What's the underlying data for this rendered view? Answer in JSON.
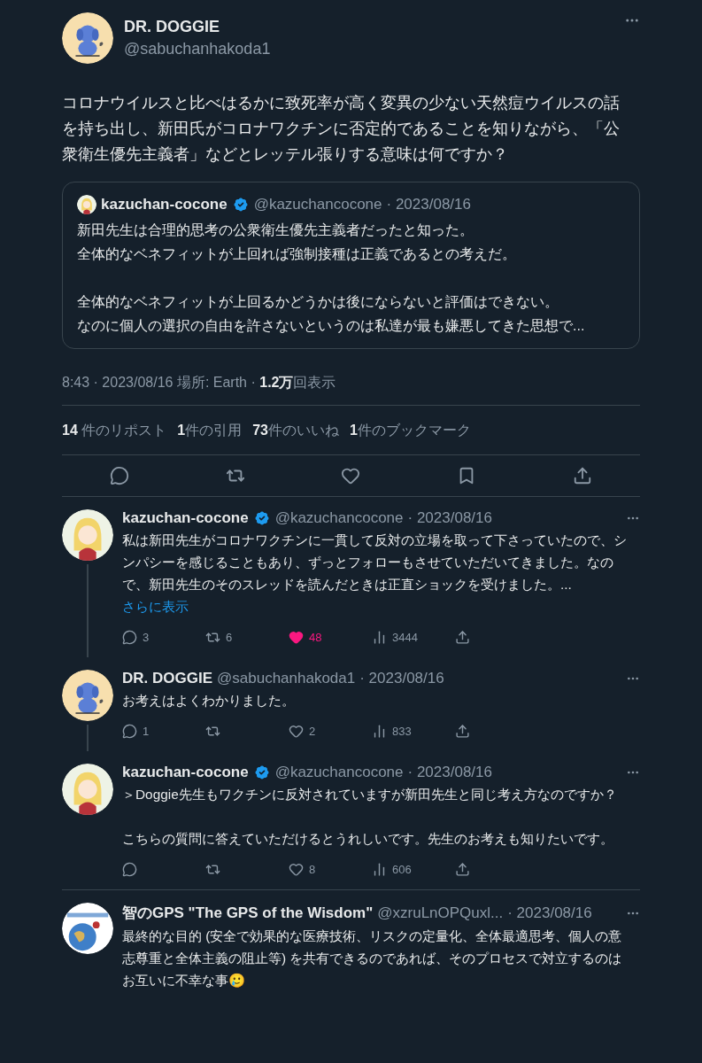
{
  "main_tweet": {
    "author": "DR. DOGGIE",
    "handle": "@sabuchanhakoda1",
    "kind": "dog",
    "text": "コロナウイルスと比べはるかに致死率が高く変異の少ない天然痘ウイルスの話を持ち出し、新田氏がコロナワクチンに否定的であることを知りながら、「公衆衛生優先主義者」などとレッテル張りする意味は何ですか？",
    "quote": {
      "author": "kazuchan-cocone",
      "verified": true,
      "handle": "@kazuchancocone",
      "date": "· 2023/08/16",
      "kind": "girl",
      "paragraphs": [
        [
          "新田先生は合理的思考の公衆衛生優先主義者だったと知った。",
          "全体的なベネフィットが上回れば強制接種は正義であるとの考えだ。"
        ],
        [
          "全体的なベネフィットが上回るかどうかは後にならないと評価はできない。",
          "なのに個人の選択の自由を許さないというのは私達が最も嫌悪してきた思想で..."
        ]
      ]
    },
    "meta": "8:43 · 2023/08/16 場所: Earth · **1.2万**回表示",
    "stats": [
      "**14** 件のリポスト",
      "**1**件の引用",
      "**73**件のいいね",
      "**1**件のブックマーク"
    ]
  },
  "replies": [
    {
      "author": "kazuchan-cocone",
      "verified": true,
      "handle": "@kazuchancocone",
      "date": "· 2023/08/16",
      "kind": "girl",
      "thread_line": true,
      "paragraphs": [
        "私は新田先生がコロナワクチンに一貫して反対の立場を取って下さっていたので、シンパシーを感じることもあり、ずっとフォローもさせていただいてきました。なので、新田先生のそのスレッドを読んだときは正直ショックを受けました。..."
      ],
      "show_more": "さらに表示",
      "replies": "3",
      "reposts": "6",
      "likes": "48",
      "liked": true,
      "views": "3444"
    },
    {
      "author": "DR. DOGGIE",
      "verified": false,
      "handle": "@sabuchanhakoda1",
      "date": "· 2023/08/16",
      "kind": "dog",
      "thread_line": true,
      "paragraphs": [
        "お考えはよくわかりました。"
      ],
      "replies": "1",
      "likes": "2",
      "liked": false,
      "views": "833"
    },
    {
      "author": "kazuchan-cocone",
      "verified": true,
      "handle": "@kazuchancocone",
      "date": "· 2023/08/16",
      "kind": "girl",
      "thread_line": false,
      "paragraphs": [
        "＞Doggie先生もワクチンに反対されていますが新田先生と同じ考え方なのですか？",
        "こちらの質問に答えていただけるとうれしいです。先生のお考えも知りたいです。"
      ],
      "likes": "8",
      "liked": false,
      "views": "606"
    },
    {
      "author": "智のGPS \"The GPS of the Wisdom\"",
      "verified": false,
      "handle": "@xzruLnOPQuxl...",
      "date": "· 2023/08/16",
      "kind": "globe",
      "thread_line": false,
      "paragraphs": [
        "最終的な目的 (安全で効果的な医療技術、リスクの定量化、全体最適思考、個人の意志尊重と全体主義の阻止等) を共有できるのであれば、そのプロセスで対立するのはお互いに不幸な事🥲"
      ]
    }
  ]
}
